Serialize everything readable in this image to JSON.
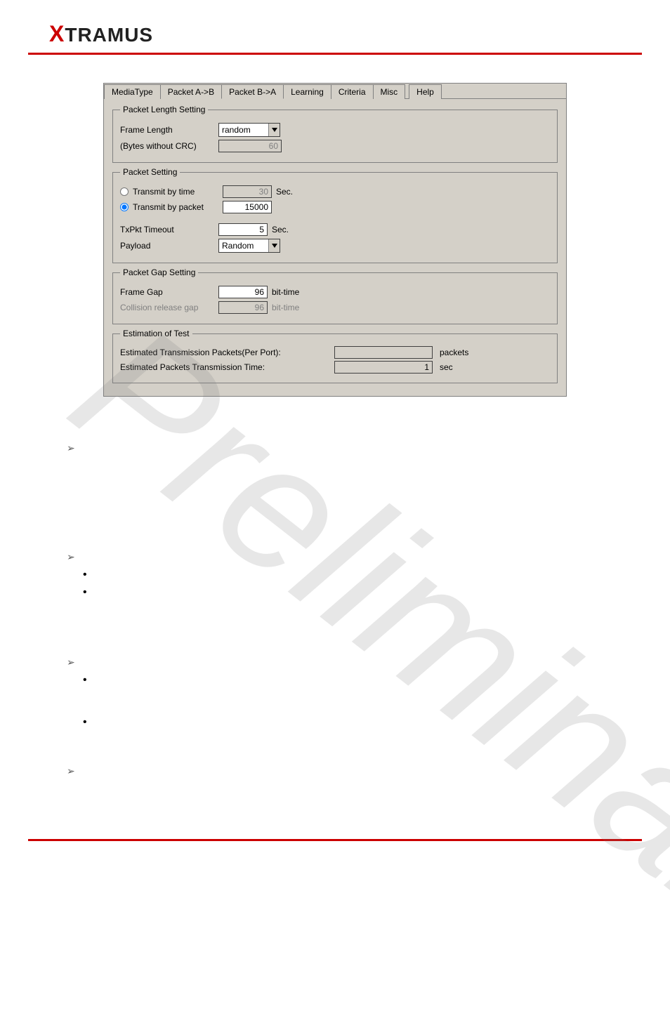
{
  "logo": {
    "x": "X",
    "rest": "TRAMUS"
  },
  "watermark_text": "Preliminary",
  "dialog": {
    "tabs": {
      "media_type": "MediaType",
      "packet_ab": "Packet A->B",
      "packet_ba": "Packet B->A",
      "learning": "Learning",
      "criteria": "Criteria",
      "misc": "Misc",
      "help": "Help"
    },
    "packet_length_setting": {
      "legend": "Packet Length Setting",
      "frame_length_label": "Frame Length",
      "frame_length_value": "random",
      "bytes_label": "(Bytes without CRC)",
      "bytes_value": "60"
    },
    "packet_setting": {
      "legend": "Packet Setting",
      "transmit_by_time_label": "Transmit by time",
      "transmit_by_time_value": "30",
      "transmit_by_time_unit": "Sec.",
      "transmit_by_packet_label": "Transmit by packet",
      "transmit_by_packet_value": "15000",
      "txpkt_timeout_label": "TxPkt Timeout",
      "txpkt_timeout_value": "5",
      "txpkt_timeout_unit": "Sec.",
      "payload_label": "Payload",
      "payload_value": "Random",
      "transmit_mode": "packet"
    },
    "packet_gap_setting": {
      "legend": "Packet Gap Setting",
      "frame_gap_label": "Frame Gap",
      "frame_gap_value": "96",
      "frame_gap_unit": "bit-time",
      "collision_label": "Collision release gap",
      "collision_value": "96",
      "collision_unit": "bit-time"
    },
    "estimation": {
      "legend": "Estimation of Test",
      "packets_label": "Estimated Transmission Packets(Per Port):",
      "packets_value": "",
      "packets_unit": "packets",
      "time_label": "Estimated Packets Transmission Time:",
      "time_value": "1",
      "time_unit": "sec"
    }
  }
}
